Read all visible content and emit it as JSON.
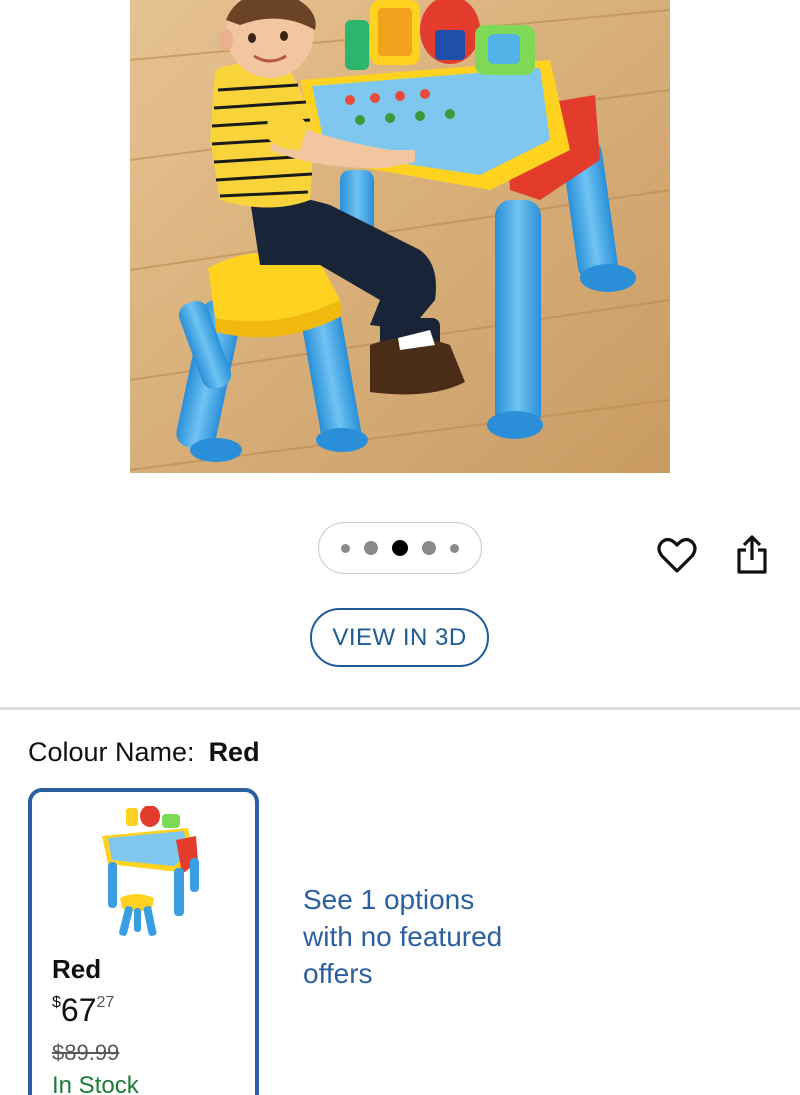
{
  "product": {
    "image_alt": "Child seated at a colourful activity desk with stool",
    "carousel": {
      "count": 5,
      "active_index": 2
    }
  },
  "actions": {
    "view_3d_label": "VIEW IN 3D"
  },
  "colour": {
    "label": "Colour Name:",
    "selected": "Red"
  },
  "swatch": {
    "name": "Red",
    "price_symbol": "$",
    "price_whole": "67",
    "price_fraction": "27",
    "was_price": "$89.99",
    "availability": "In Stock"
  },
  "other_options": {
    "text": "See 1 options with no featured offers"
  },
  "colors": {
    "link_blue": "#2c5fa0",
    "in_stock_green": "#1e7b34",
    "view3d_border": "#1f5c94"
  }
}
